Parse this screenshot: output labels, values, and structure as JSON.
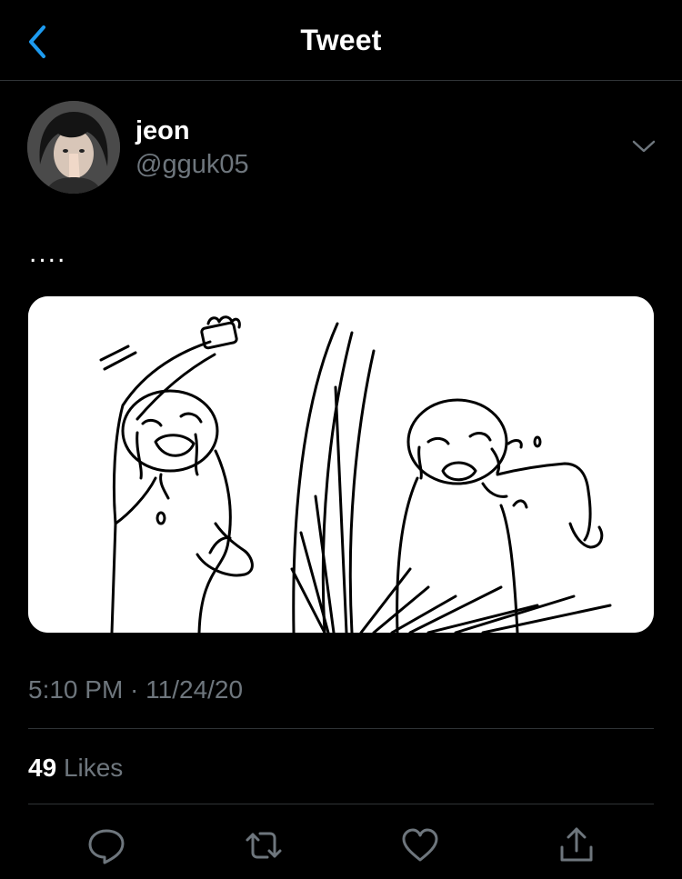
{
  "nav": {
    "title": "Tweet",
    "back_icon": "chevron-left-icon"
  },
  "tweet": {
    "author": {
      "display_name": "jeon",
      "handle": "@gguk05"
    },
    "menu_icon": "chevron-down-icon",
    "text": "....",
    "media_description_icon": "cartoon-image",
    "timestamp": "5:10 PM · 11/24/20",
    "likes_count": "49",
    "likes_label": "Likes"
  },
  "actions": [
    {
      "name": "reply",
      "icon": "reply-icon"
    },
    {
      "name": "retweet",
      "icon": "retweet-icon"
    },
    {
      "name": "like",
      "icon": "heart-icon"
    },
    {
      "name": "share",
      "icon": "share-icon"
    }
  ],
  "colors": {
    "background": "#000000",
    "accent": "#1d9bf0",
    "secondary_text": "#6e767d",
    "divider": "#2f3336"
  }
}
